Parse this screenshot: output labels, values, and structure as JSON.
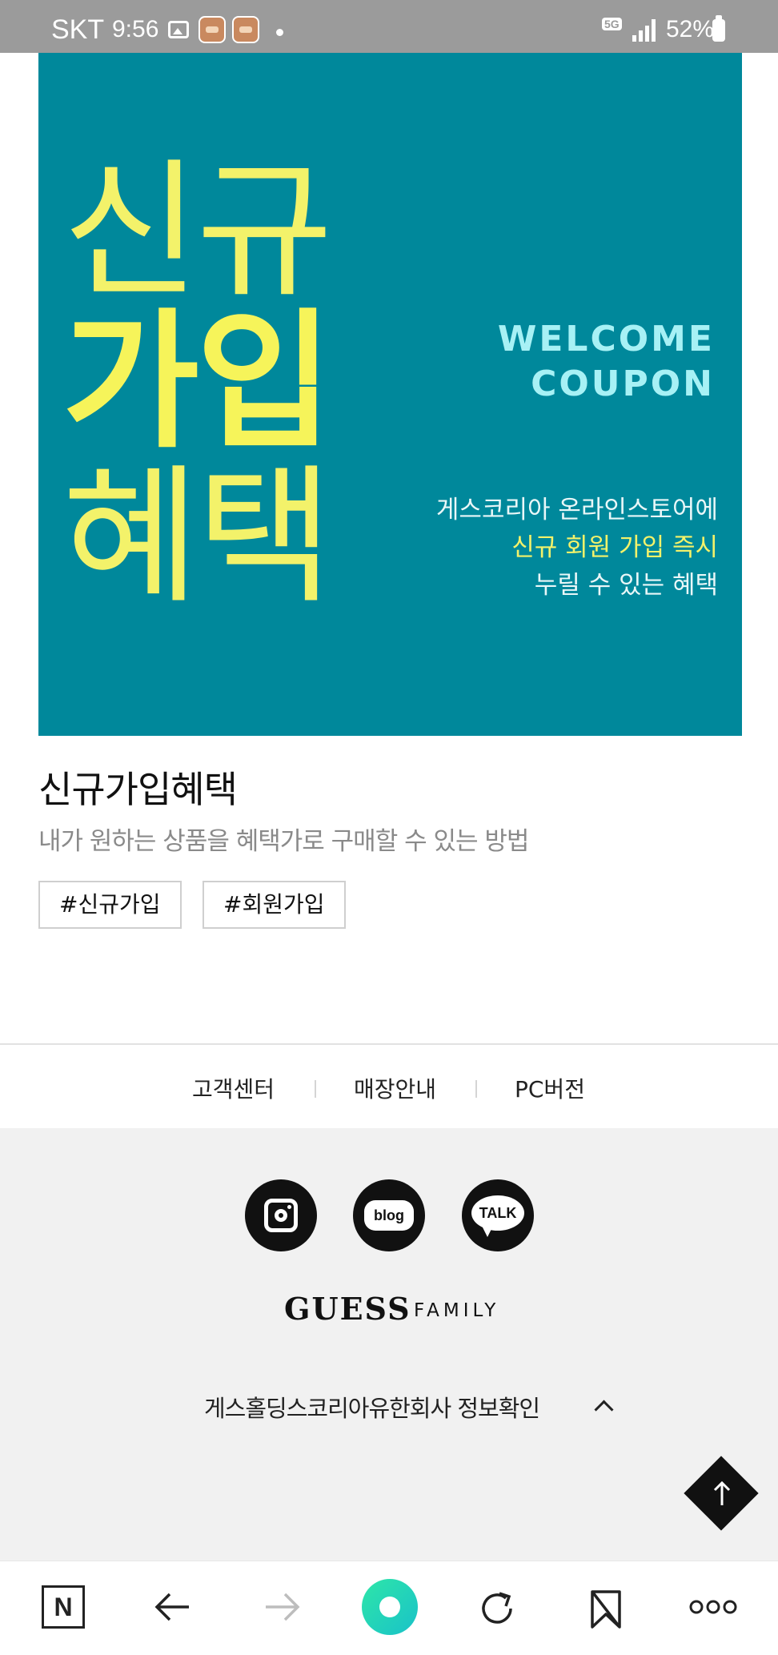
{
  "status_bar": {
    "carrier": "SKT",
    "time": "9:56",
    "network": "5G",
    "battery": "52%"
  },
  "banner": {
    "line1": "신규",
    "line2": "가입",
    "line3": "혜택",
    "welcome_line1": "WELCOME",
    "welcome_line2": "COUPON",
    "desc_line1": "게스코리아 온라인스토어에",
    "desc_line2": "신규 회원 가입 즉시",
    "desc_line3": "누릴 수 있는 혜택",
    "bg_color": "#00889b",
    "accent_color": "#f3f26a"
  },
  "article": {
    "title": "신규가입혜택",
    "subtitle": "내가 원하는 상품을 혜택가로 구매할 수 있는 방법",
    "tags": [
      "#신규가입",
      "#회원가입"
    ]
  },
  "footer": {
    "links": [
      "고객센터",
      "매장안내",
      "PC버전"
    ],
    "sns": [
      "instagram-icon",
      "blog-icon",
      "kakaotalk-icon"
    ],
    "blog_label": "blog",
    "talk_label": "TALK",
    "logo_main": "GUESS",
    "logo_sub": "FAMILY",
    "company_info": "게스홀딩스코리아유한회사 정보확인"
  },
  "browser_nav": {
    "n_label": "N",
    "icons": [
      "naver-n-icon",
      "back-arrow-icon",
      "forward-arrow-icon",
      "home-icon",
      "refresh-icon",
      "bookmark-icon",
      "more-icon"
    ]
  }
}
